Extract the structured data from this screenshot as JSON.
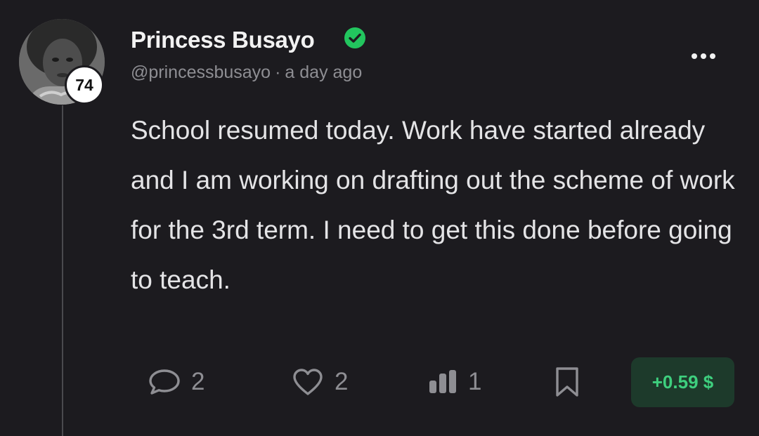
{
  "author": {
    "name": "Princess Busayo",
    "handle": "@princessbusayo",
    "reputation": "74",
    "verified": true,
    "avatar_icon": "profile-photo"
  },
  "post": {
    "separator": "·",
    "time_ago": "a day ago",
    "body": "School resumed today. Work have started already and I am working on drafting out the scheme of work for the 3rd term. I need to get this done before going to teach."
  },
  "actions": {
    "comments_count": "2",
    "likes_count": "2",
    "views_count": "1",
    "earnings_label": "+0.59 $"
  },
  "colors": {
    "background": "#1c1b1f",
    "verified": "#22c55e",
    "earnings_text": "#3ecf7e",
    "earnings_bg": "#1d3a2b",
    "muted_text": "#8e8e93"
  }
}
